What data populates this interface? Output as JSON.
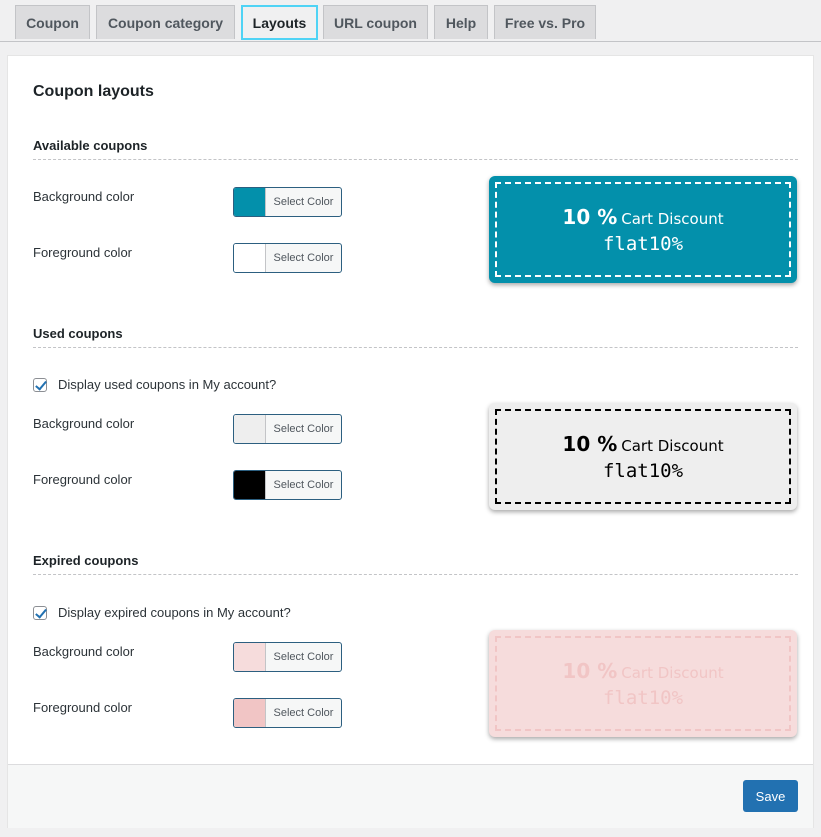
{
  "tabs": [
    {
      "label": "Coupon"
    },
    {
      "label": "Coupon category"
    },
    {
      "label": "Layouts"
    },
    {
      "label": "URL coupon"
    },
    {
      "label": "Help"
    },
    {
      "label": "Free vs. Pro"
    }
  ],
  "active_tab": "Layouts",
  "page_title": "Coupon layouts",
  "select_color_label": "Select Color",
  "sections": {
    "available": {
      "title": "Available coupons",
      "background_label": "Background color",
      "foreground_label": "Foreground color",
      "background_color": "#0390ab",
      "foreground_color": "#ffffff"
    },
    "used": {
      "title": "Used coupons",
      "checkbox_label": "Display used coupons in My account?",
      "checkbox_checked": true,
      "background_label": "Background color",
      "foreground_label": "Foreground color",
      "background_color": "#eeeeee",
      "foreground_color": "#000000"
    },
    "expired": {
      "title": "Expired coupons",
      "checkbox_label": "Display expired coupons in My account?",
      "checkbox_checked": true,
      "background_label": "Background color",
      "foreground_label": "Foreground color",
      "background_color": "#f6dcdc",
      "foreground_color": "#f1c5c5"
    }
  },
  "coupon_preview": {
    "amount": "10 %",
    "description": "Cart Discount",
    "code": "flat10%"
  },
  "save_label": "Save"
}
